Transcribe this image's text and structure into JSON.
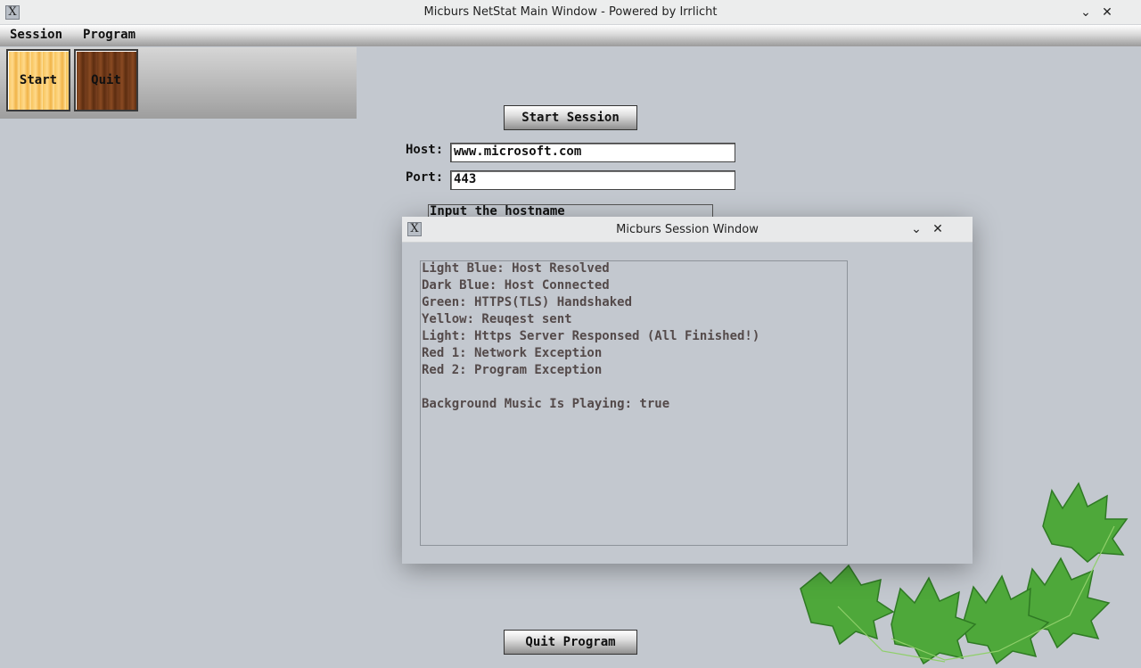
{
  "window": {
    "title": "Micburs NetStat Main Window - Powered by Irrlicht",
    "app_icon_glyph": "X",
    "minimize_glyph": "⌄",
    "close_glyph": "✕"
  },
  "menubar": {
    "items": [
      {
        "label": "Session"
      },
      {
        "label": "Program"
      }
    ]
  },
  "toolbar": {
    "start_label": "Start",
    "quit_label": "Quit"
  },
  "main": {
    "start_session_label": "Start Session",
    "host_label": "Host:",
    "host_value": "www.microsoft.com",
    "port_label": "Port:",
    "port_value": "443",
    "tooltip": "Input the hostname",
    "quit_program_label": "Quit Program"
  },
  "session_window": {
    "title": "Micburs Session Window",
    "app_icon_glyph": "X",
    "minimize_glyph": "⌄",
    "close_glyph": "✕",
    "log_lines": [
      "Light Blue: Host Resolved",
      "Dark Blue: Host Connected",
      "Green: HTTPS(TLS) Handshaked",
      "Yellow: Reuqest sent",
      "Light: Https Server Responsed (All Finished!)",
      "Red 1: Network Exception",
      "Red 2: Program Exception",
      "",
      "Background Music Is Playing: true"
    ]
  },
  "colors": {
    "background": "#c3c8cf",
    "log_text": "#544a4a",
    "start_wood": "#f7c45c",
    "quit_wood": "#6b3717",
    "leaf_green": "#4ea83a"
  }
}
